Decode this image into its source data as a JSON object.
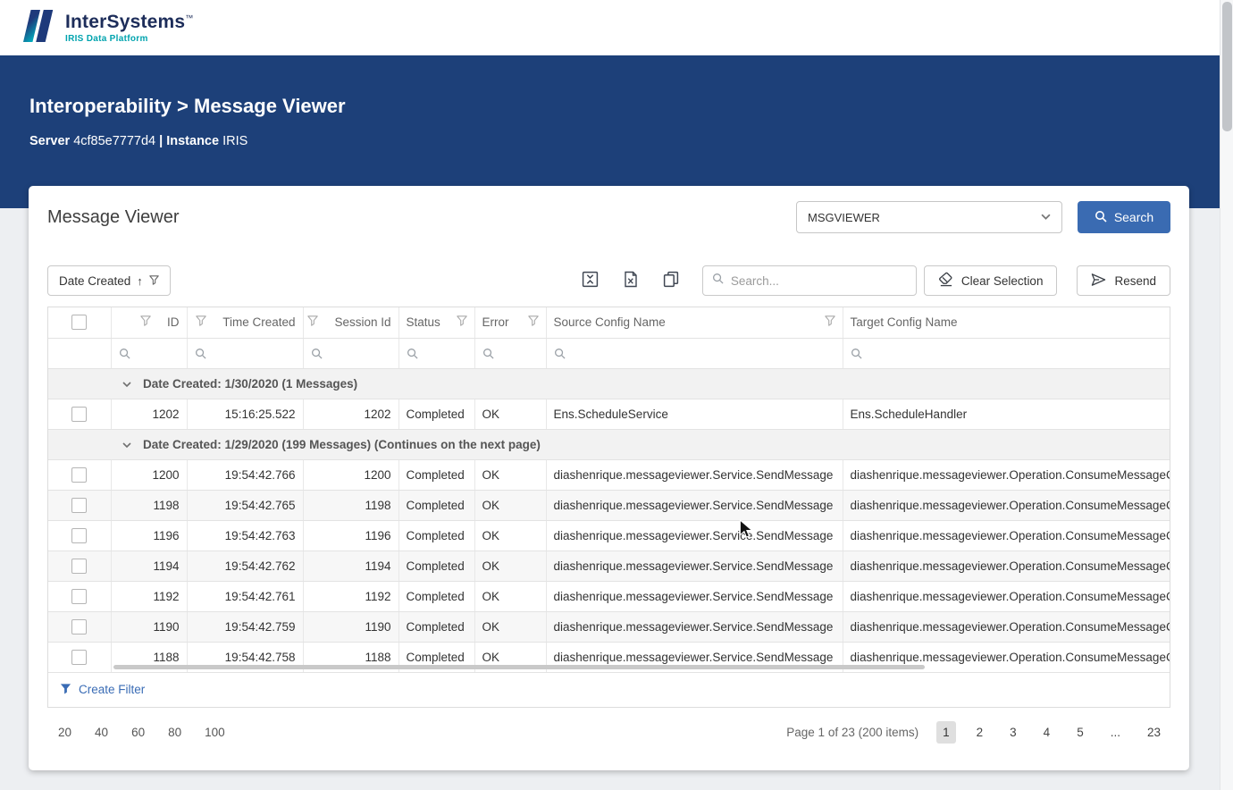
{
  "brand": {
    "name": "InterSystems",
    "tm": "™",
    "subtitle": "IRIS Data Platform"
  },
  "hero": {
    "title": "Interoperability > Message Viewer",
    "server_label": "Server",
    "server_value": "4cf85e7777d4",
    "divider": "|",
    "instance_label": "Instance",
    "instance_value": "IRIS"
  },
  "panel": {
    "title": "Message Viewer",
    "namespace_select": {
      "value": "MSGVIEWER"
    },
    "search_button": "Search"
  },
  "toolbar": {
    "sort_button": {
      "label": "Date Created",
      "arrow": "↑"
    },
    "search": {
      "placeholder": "Search..."
    },
    "clear_selection": "Clear Selection",
    "resend": "Resend"
  },
  "table": {
    "columns": [
      "ID",
      "Time Created",
      "Session Id",
      "Status",
      "Error",
      "Source Config Name",
      "Target Config Name"
    ],
    "groups": [
      {
        "label": "Date Created: 1/30/2020 (1 Messages)",
        "rows": [
          [
            "1202",
            "15:16:25.522",
            "1202",
            "Completed",
            "OK",
            "Ens.ScheduleService",
            "Ens.ScheduleHandler"
          ]
        ]
      },
      {
        "label": "Date Created: 1/29/2020 (199 Messages) (Continues on the next page)",
        "rows": [
          [
            "1200",
            "19:54:42.766",
            "1200",
            "Completed",
            "OK",
            "diashenrique.messageviewer.Service.SendMessage",
            "diashenrique.messageviewer.Operation.ConsumeMessageC"
          ],
          [
            "1198",
            "19:54:42.765",
            "1198",
            "Completed",
            "OK",
            "diashenrique.messageviewer.Service.SendMessage",
            "diashenrique.messageviewer.Operation.ConsumeMessageC"
          ],
          [
            "1196",
            "19:54:42.763",
            "1196",
            "Completed",
            "OK",
            "diashenrique.messageviewer.Service.SendMessage",
            "diashenrique.messageviewer.Operation.ConsumeMessageC"
          ],
          [
            "1194",
            "19:54:42.762",
            "1194",
            "Completed",
            "OK",
            "diashenrique.messageviewer.Service.SendMessage",
            "diashenrique.messageviewer.Operation.ConsumeMessageC"
          ],
          [
            "1192",
            "19:54:42.761",
            "1192",
            "Completed",
            "OK",
            "diashenrique.messageviewer.Service.SendMessage",
            "diashenrique.messageviewer.Operation.ConsumeMessageC"
          ],
          [
            "1190",
            "19:54:42.759",
            "1190",
            "Completed",
            "OK",
            "diashenrique.messageviewer.Service.SendMessage",
            "diashenrique.messageviewer.Operation.ConsumeMessageC"
          ],
          [
            "1188",
            "19:54:42.758",
            "1188",
            "Completed",
            "OK",
            "diashenrique.messageviewer.Service.SendMessage",
            "diashenrique.messageviewer.Operation.ConsumeMessageC"
          ]
        ]
      }
    ],
    "footer_link": "Create Filter"
  },
  "pagination": {
    "page_sizes": [
      "20",
      "40",
      "60",
      "80",
      "100"
    ],
    "info": "Page 1 of 23 (200 items)",
    "pages": [
      "1",
      "2",
      "3",
      "4",
      "5",
      "...",
      "23"
    ],
    "active_page": "1"
  }
}
